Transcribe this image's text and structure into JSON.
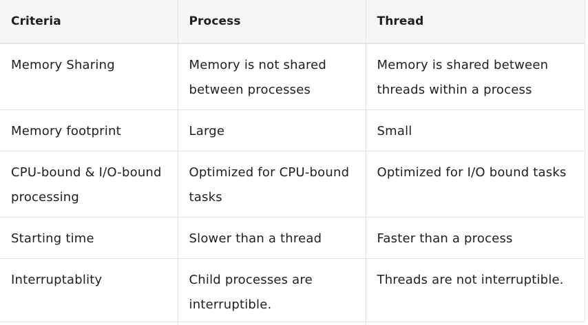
{
  "table": {
    "headers": [
      "Criteria",
      "Process",
      "Thread"
    ],
    "rows": [
      [
        "Memory Sharing",
        "Memory is not shared between processes",
        "Memory is shared between threads within a process"
      ],
      [
        "Memory footprint",
        "Large",
        "Small"
      ],
      [
        "CPU-bound & I/O-bound processing",
        "Optimized for CPU-bound tasks",
        "Optimized for I/O bound tasks"
      ],
      [
        "Starting time",
        "Slower than a thread",
        "Faster than a process"
      ],
      [
        "Interruptablity",
        "Child processes are interruptible.",
        "Threads are not interruptible."
      ]
    ]
  }
}
